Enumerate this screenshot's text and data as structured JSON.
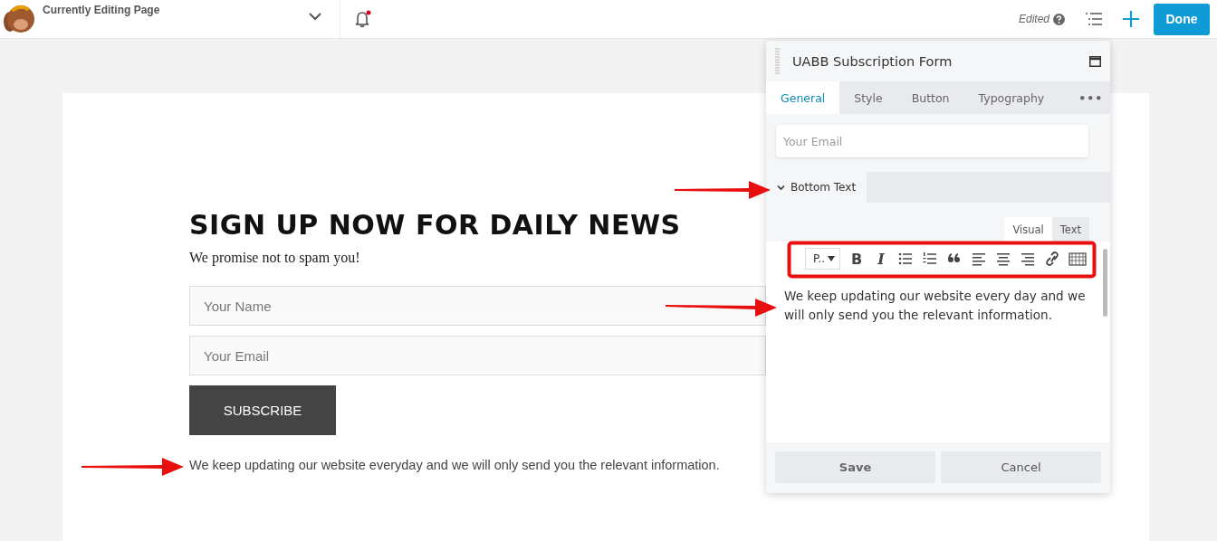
{
  "topbar": {
    "title": "Currently Editing Page",
    "notification_unread": true,
    "status": "Edited",
    "done_button": "Done"
  },
  "page": {
    "heading": "SIGN UP NOW FOR DAILY NEWS",
    "subheading": "We promise not to spam you!",
    "fields": [
      {
        "placeholder": "Your Name"
      },
      {
        "placeholder": "Your Email"
      }
    ],
    "button": "SUBSCRIBE",
    "bottom_text": "We keep updating our website everyday and we will only send you the relevant information."
  },
  "panel": {
    "title": "UABB Subscription Form",
    "tabs": [
      {
        "label": "General",
        "selected": true
      },
      {
        "label": "Style",
        "selected": false
      },
      {
        "label": "Button",
        "selected": false
      },
      {
        "label": "Typography",
        "selected": false
      },
      {
        "label": "•••",
        "selected": false
      }
    ],
    "email_field": {
      "placeholder": "Your Email"
    },
    "section": {
      "label": "Bottom Text",
      "expanded": true
    },
    "editor_tabs": [
      {
        "label": "Visual",
        "selected": true
      },
      {
        "label": "Text",
        "selected": false
      }
    ],
    "toolbar": [
      {
        "kind": "select",
        "label": "P.."
      },
      {
        "kind": "bold",
        "label": "B"
      },
      {
        "kind": "italic",
        "label": "I"
      },
      {
        "kind": "bullets"
      },
      {
        "kind": "numbers"
      },
      {
        "kind": "quote"
      },
      {
        "kind": "align-left"
      },
      {
        "kind": "align-center"
      },
      {
        "kind": "align-right"
      },
      {
        "kind": "link"
      },
      {
        "kind": "keyboard"
      }
    ],
    "editor_text": "We keep updating our website every day and we will only send you the relevant information.",
    "buttons": [
      {
        "label": "Save"
      },
      {
        "label": "Cancel"
      }
    ]
  }
}
